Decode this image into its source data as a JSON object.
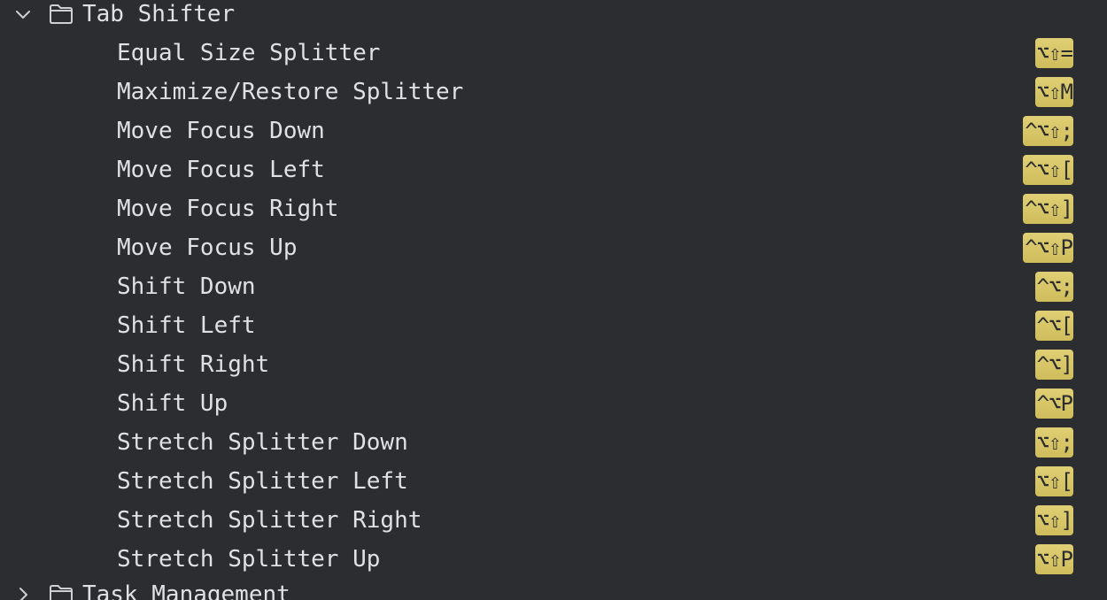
{
  "groups": [
    {
      "label": "Tab Shifter",
      "expanded": true,
      "items": [
        {
          "label": "Equal Size Splitter",
          "shortcut": "⌥⇧="
        },
        {
          "label": "Maximize/Restore Splitter",
          "shortcut": "⌥⇧M"
        },
        {
          "label": "Move Focus Down",
          "shortcut": "^⌥⇧;"
        },
        {
          "label": "Move Focus Left",
          "shortcut": "^⌥⇧["
        },
        {
          "label": "Move Focus Right",
          "shortcut": "^⌥⇧]"
        },
        {
          "label": "Move Focus Up",
          "shortcut": "^⌥⇧P"
        },
        {
          "label": "Shift Down",
          "shortcut": "^⌥;"
        },
        {
          "label": "Shift Left",
          "shortcut": "^⌥["
        },
        {
          "label": "Shift Right",
          "shortcut": "^⌥]"
        },
        {
          "label": "Shift Up",
          "shortcut": "^⌥P"
        },
        {
          "label": "Stretch Splitter Down",
          "shortcut": "⌥⇧;"
        },
        {
          "label": "Stretch Splitter Left",
          "shortcut": "⌥⇧["
        },
        {
          "label": "Stretch Splitter Right",
          "shortcut": "⌥⇧]"
        },
        {
          "label": "Stretch Splitter Up",
          "shortcut": "⌥⇧P"
        }
      ]
    },
    {
      "label": "Task Management",
      "expanded": false,
      "items": []
    }
  ],
  "icons": {
    "expanded": "chevron-down-icon",
    "collapsed": "chevron-right-icon",
    "folder": "folder-icon"
  },
  "colors": {
    "background": "#2b2d30",
    "text": "#dfe1e5",
    "shortcut_badge": "#d8c66a",
    "icon_stroke": "#ced0d6"
  }
}
